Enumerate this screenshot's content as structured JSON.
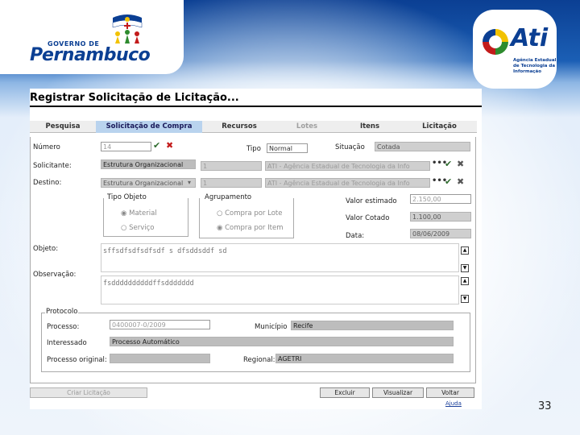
{
  "branding": {
    "gov_top": "GOVERNO DE",
    "gov_name": "Pernambuco",
    "ati_name": "Ati",
    "ati_sub": "Agência Estadual de Tecnologia da Informação"
  },
  "window": {
    "title": "Registrar Solicitação de Licitação..."
  },
  "tabs": [
    {
      "label": "Pesquisa",
      "state": "normal"
    },
    {
      "label": "Solicitação de Compra",
      "state": "active"
    },
    {
      "label": "Recursos",
      "state": "normal"
    },
    {
      "label": "Lotes",
      "state": "disabled"
    },
    {
      "label": "Itens",
      "state": "normal"
    },
    {
      "label": "Licitação",
      "state": "normal"
    }
  ],
  "form": {
    "numero_label": "Número",
    "numero_value": "14",
    "tipo_label": "Tipo",
    "tipo_value": "Normal",
    "situacao_label": "Situação",
    "situacao_value": "Cotada",
    "solicitante_label": "Solicitante:",
    "solicitante_value": "Estrutura Organizacional",
    "solicitante_code": "1",
    "solicitante_org": "ATI - Agência Estadual de Tecnologia da Info",
    "destino_label": "Destino:",
    "destino_value": "Estrutura Organizacional",
    "destino_code": "1",
    "destino_org": "ATI - Agência Estadual de Tecnologia da Info",
    "tipo_objeto_label": "Tipo Objeto",
    "tipo_objeto_opt1": "Material",
    "tipo_objeto_opt2": "Serviço",
    "agrupamento_label": "Agrupamento",
    "agrupamento_opt1": "Compra por Lote",
    "agrupamento_opt2": "Compra por Item",
    "valor_estimado_label": "Valor estimado",
    "valor_estimado_value": "2.150,00",
    "valor_cotado_label": "Valor Cotado",
    "valor_cotado_value": "1.100,00",
    "data_label": "Data:",
    "data_value": "08/06/2009",
    "objeto_label": "Objeto:",
    "objeto_value": "sffsdfsdfsdfsdf s dfsddsddf sd",
    "observacao_label": "Observação:",
    "observacao_value": "fsddddddddddffsddddddd"
  },
  "protocolo": {
    "title": "Protocolo",
    "processo_label": "Processo:",
    "processo_value": "0400007-0/2009",
    "municipio_label": "Município",
    "municipio_value": "Recife",
    "interessado_label": "Interessado",
    "interessado_value": "Processo Automático",
    "processo_original_label": "Processo original:",
    "processo_original_value": "",
    "regional_label": "Regional:",
    "regional_value": "AGETRI"
  },
  "buttons": {
    "criar_licitacao": "Criar Licitação",
    "excluir": "Excluir",
    "visualizar": "Visualizar",
    "voltar": "Voltar",
    "ajuda": "Ajuda"
  },
  "slide": {
    "page_number": "33"
  }
}
